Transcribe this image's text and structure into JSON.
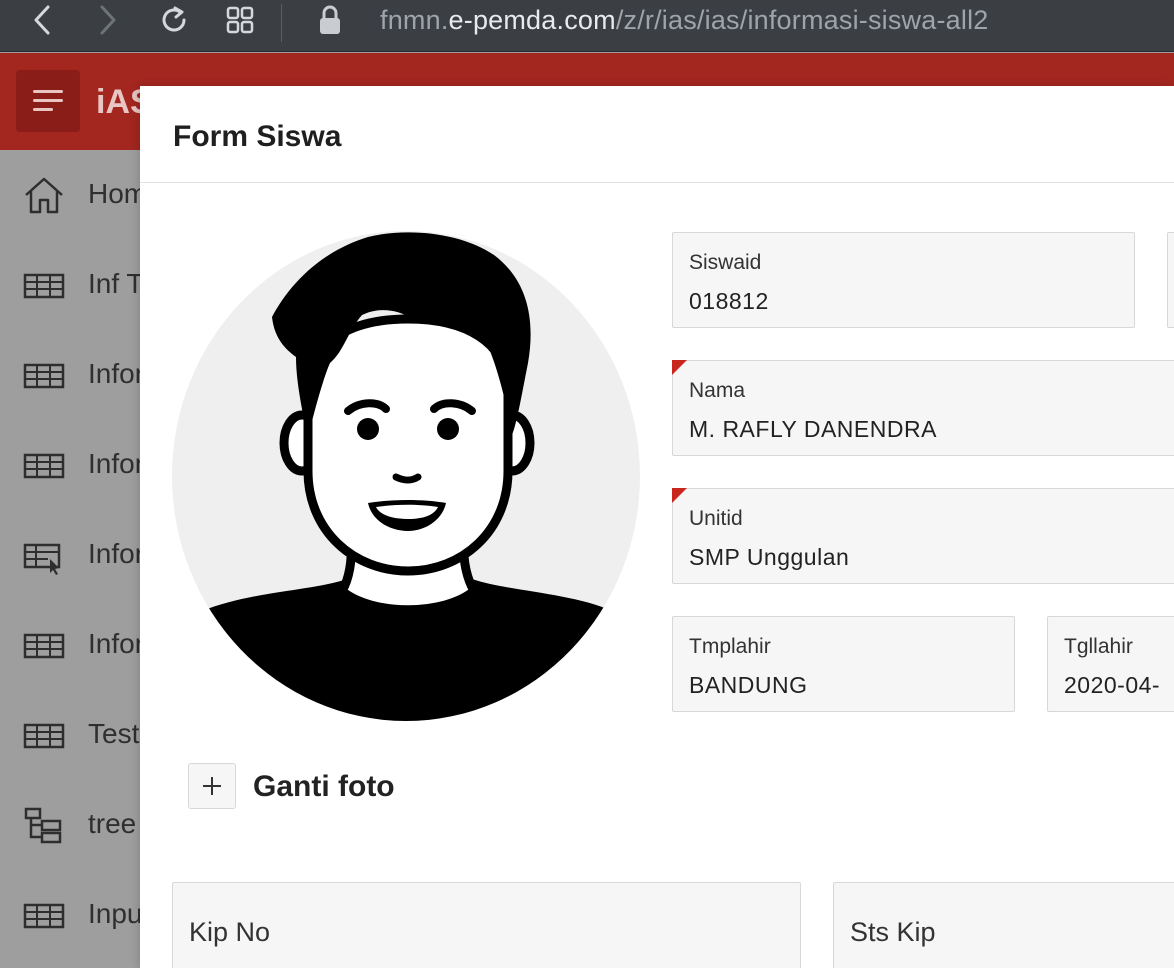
{
  "browser": {
    "url_prefix": "fnmn.",
    "url_host": "e-pemda.com",
    "url_path": "/z/r/ias/ias/informasi-siswa-all2"
  },
  "app": {
    "title": "iAS"
  },
  "sidenav": {
    "items": [
      {
        "label": "Hom",
        "icon": "home-icon"
      },
      {
        "label": "Inf T",
        "icon": "table-icon"
      },
      {
        "label": "Infor",
        "icon": "table-icon"
      },
      {
        "label": "Infor",
        "icon": "table-icon"
      },
      {
        "label": "Infor",
        "icon": "table-cursor-icon"
      },
      {
        "label": "Infor",
        "icon": "table-icon"
      },
      {
        "label": "Test",
        "icon": "table-icon"
      },
      {
        "label": "tree",
        "icon": "tree-icon"
      },
      {
        "label": "Inpu",
        "icon": "table-icon"
      }
    ]
  },
  "dialog": {
    "title": "Form Siswa",
    "photo_button_label": "Ganti foto",
    "fields": {
      "siswaid": {
        "label": "Siswaid",
        "value": "018812"
      },
      "nama": {
        "label": "Nama",
        "value": "M. RAFLY DANENDRA"
      },
      "unitid": {
        "label": "Unitid",
        "value": "SMP Unggulan"
      },
      "tmplahir": {
        "label": "Tmplahir",
        "value": "BANDUNG"
      },
      "tgllahir": {
        "label": "Tgllahir",
        "value": "2020-04-"
      },
      "kipno": {
        "label": "Kip No",
        "value": ""
      },
      "stskip": {
        "label": "Sts Kip",
        "value": ""
      }
    }
  },
  "colors": {
    "header_red": "#a3261f",
    "required_marker": "#c9261e",
    "browser_bar": "#3b3f43"
  }
}
